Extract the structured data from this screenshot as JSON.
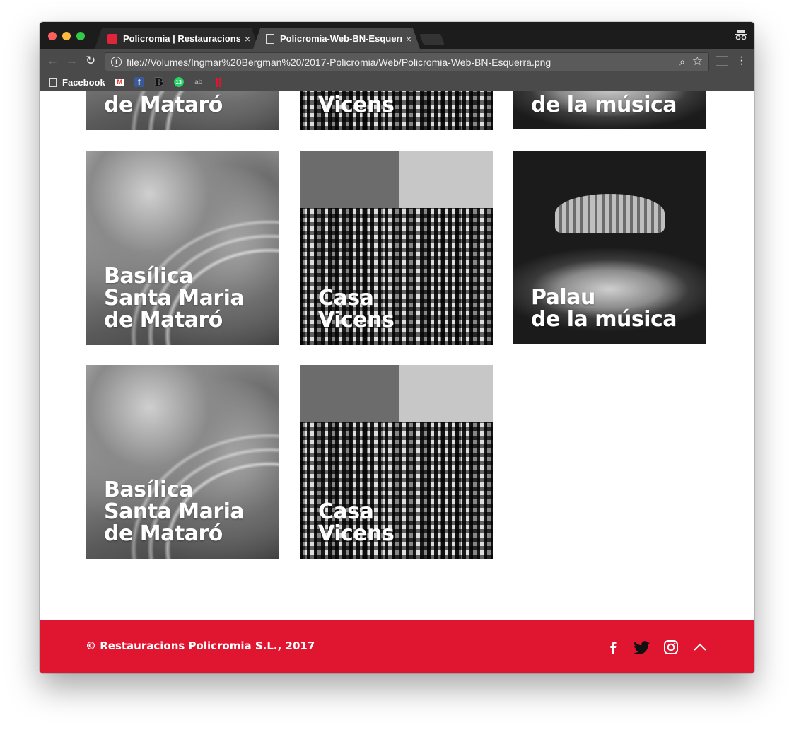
{
  "browser": {
    "tabs": [
      {
        "title": "Policromia | Restauracions",
        "favicon": "red-square-icon",
        "active": false
      },
      {
        "title": "Policromia-Web-BN-Esquerra.",
        "favicon": "document-icon",
        "active": true
      }
    ],
    "close_glyph": "×",
    "url": "file:///Volumes/Ingmar%20Bergman%20/2017-Policromia/Web/Policromia-Web-BN-Esquerra.png"
  },
  "bookmarks": {
    "items": [
      {
        "label": "Facebook",
        "icon": "page-icon"
      }
    ],
    "icons": [
      "gmail-icon",
      "facebook-icon",
      "bold-b-icon",
      "whatsapp-icon",
      "ab-icon",
      "pause-icon"
    ]
  },
  "gallery": {
    "top_row": [
      {
        "caption": "de Mataró"
      },
      {
        "caption": "Vicens"
      },
      {
        "caption": "de la música"
      }
    ],
    "tiles": [
      {
        "line1": "Basílica",
        "line2": "Santa Maria",
        "line3": "de Mataró"
      },
      {
        "line1": "Casa",
        "line2": "Vicens"
      },
      {
        "line1": "Palau",
        "line2": "de la música"
      },
      {
        "line1": "Basílica",
        "line2": "Santa Maria",
        "line3": "de Mataró"
      },
      {
        "line1": "Casa",
        "line2": "Vicens"
      }
    ]
  },
  "footer": {
    "copyright": "© Restauracions Policromia S.L., 2017",
    "background": "#e0152f",
    "icons": [
      "facebook-icon",
      "twitter-icon",
      "instagram-icon",
      "chevron-up-icon"
    ]
  }
}
